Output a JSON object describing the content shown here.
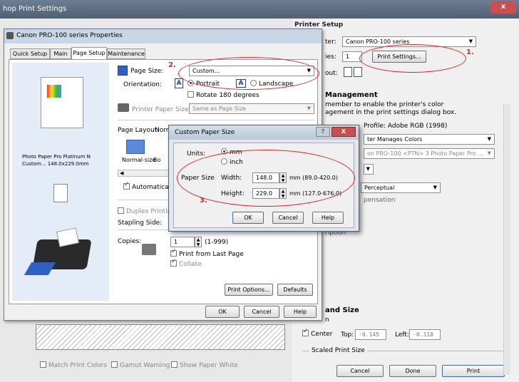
{
  "outer": {
    "title": "hop Print Settings",
    "close_label": "x",
    "printer_setup_header": "Printer Setup",
    "printer_label": "ter:",
    "printer_value": "Canon PRO-100 series",
    "copies_label": "ies:",
    "copies_value": "1",
    "print_settings_label": "Print Settings...",
    "layout_label": "out:",
    "color_mgmt_header": "Management",
    "color_note_line1": "member to enable the printer's color",
    "color_note_line2": "agement in the print settings dialog box.",
    "profile_label": "Profile: Adobe RGB (1998)",
    "handling_value": "ter Manages Colors",
    "printer_profile_value": "on PRO-100 <PTN> 3 Photo Paper Pro ...",
    "intent_value": "Perceptual",
    "bpc_label": "pensation",
    "description_label": "ription",
    "position_size_header": "and Size",
    "position_label": "n",
    "center_label": "Center",
    "top_label": "Top:",
    "top_value": "-0.145",
    "left_label": "Left:",
    "left_value": "-0.118",
    "scaled_print_size_label": "Scaled Print Size",
    "match_print_colors": "Match Print Colors",
    "gamut_warning": "Gamut Warning",
    "show_paper_white": "Show Paper White",
    "cancel_label": "Cancel",
    "done_label": "Done",
    "print_label": "Print",
    "hidden_header": "Printer Setup"
  },
  "props": {
    "title": "Canon PRO-100 series Properties",
    "tabs": [
      "Quick Setup",
      "Main",
      "Page Setup",
      "Maintenance"
    ],
    "page_size_label": "Page Size:",
    "page_size_value": "Custom...",
    "orientation_label": "Orientation:",
    "portrait_label": "Portrait",
    "landscape_label": "Landscape",
    "rotate_label": "Rotate 180 degrees",
    "printer_paper_size_label": "Printer Paper Size:",
    "printer_paper_size_value": "Same as Page Size",
    "page_layout_label": "Page Layout:",
    "page_layout_value": "Norm",
    "normal_size_label": "Normal-size",
    "bo_label": "Bo",
    "auto_label": "Automatically",
    "duplex_label": "Duplex Printing (M",
    "stapling_label": "Stapling Side:",
    "copies_label": "Copies:",
    "copies_value": "1",
    "copies_range": "(1-999)",
    "print_last_label": "Print from Last Page",
    "collate_label": "Collate",
    "preview_line1": "Photo Paper Pro Platinum N",
    "preview_line2": "Custom... 148.0x229.0mm",
    "print_options_label": "Print Options...",
    "defaults_label": "Defaults",
    "ok_label": "OK",
    "cancel_label": "Cancel",
    "help_label": "Help"
  },
  "custom": {
    "title": "Custom Paper Size",
    "units_label": "Units:",
    "mm_label": "mm",
    "inch_label": "inch",
    "paper_size_label": "Paper Size",
    "width_label": "Width:",
    "width_value": "148.0",
    "width_range": "mm (89.0-420.0)",
    "height_label": "Height:",
    "height_value": "229.0",
    "height_range": "mm (127.0-676.0)",
    "ok_label": "OK",
    "cancel_label": "Cancel",
    "help_label": "Help",
    "question_label": "?",
    "close_label": "X"
  },
  "annotations": [
    "1.",
    "2.",
    "3."
  ],
  "colors": {
    "accent": "#3a6ea5",
    "annotation": "#e02020",
    "title_bar": "#5b6f86"
  }
}
